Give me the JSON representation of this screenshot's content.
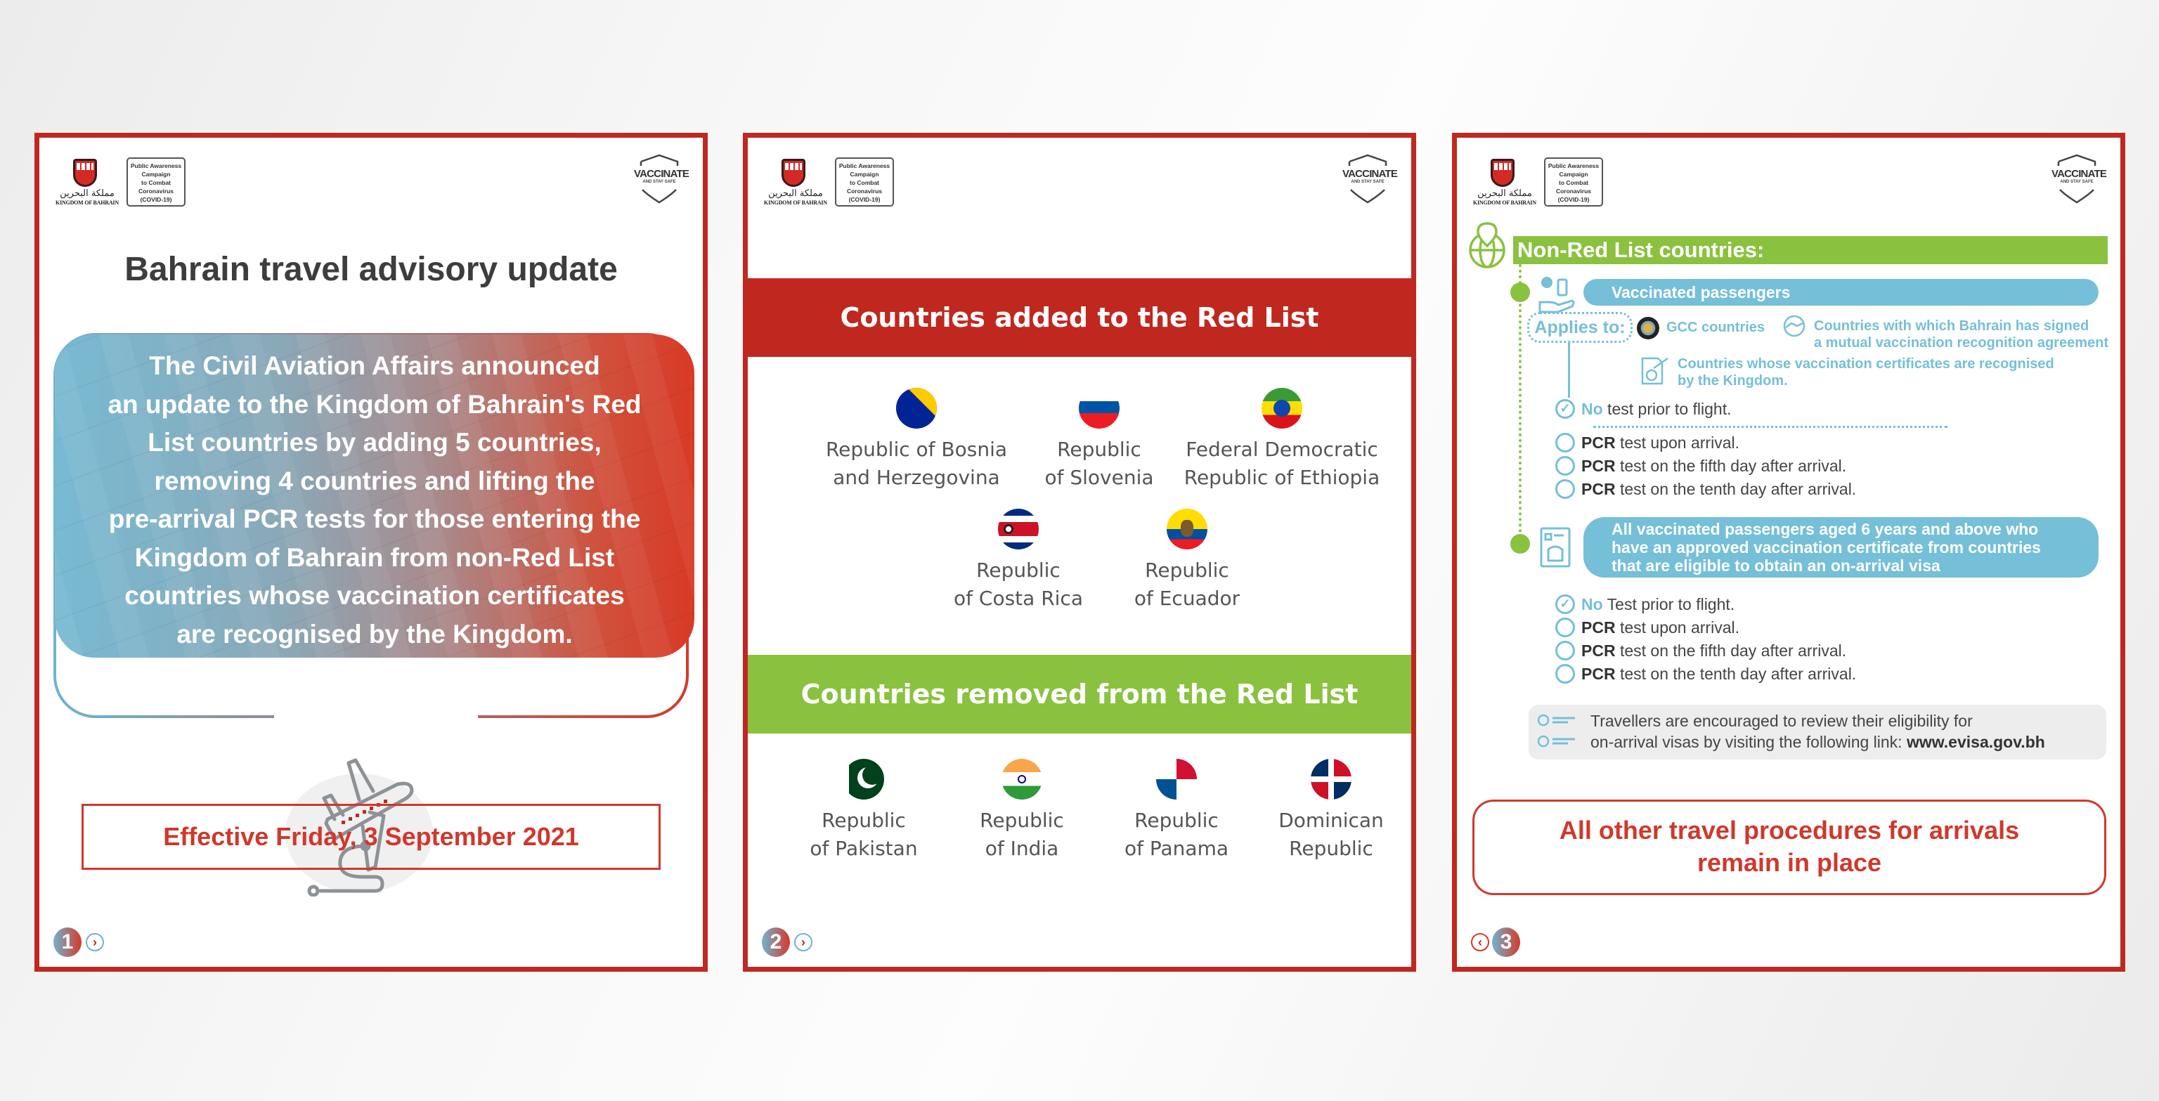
{
  "header": {
    "crest_arabic": "مملكة البحرين",
    "crest_english": "KINGDOM OF BAHRAIN",
    "campaign_lines": [
      "Public Awareness",
      "Campaign",
      "to Combat",
      "Coronavirus",
      "(COVID-19)"
    ],
    "vaccinate_title": "VACCINATE",
    "vaccinate_subtitle": "AND STAY SAFE"
  },
  "colors": {
    "border_red": "#c0281f",
    "accent_red": "#d0382c",
    "green": "#8ac13f",
    "cyan": "#75bfd8",
    "title_gray": "#3d3d3d"
  },
  "panel1": {
    "title": "Bahrain travel advisory update",
    "body_lines": [
      "The Civil Aviation Affairs announced",
      "an update to the Kingdom of Bahrain's Red",
      "List countries by adding 5 countries,",
      "removing 4 countries and lifting the",
      "pre-arrival PCR tests for those entering the",
      "Kingdom of Bahrain from non-Red List",
      "countries whose vaccination certificates",
      "are recognised by the Kingdom."
    ],
    "icon": "airplane-takeoff-icon",
    "effective": "Effective Friday, 3 September 2021",
    "page_number": "1",
    "next_arrow": "›"
  },
  "panel2": {
    "added_heading": "Countries added to the Red List",
    "added": [
      {
        "line1": "Republic of Bosnia",
        "line2": "and Herzegovina",
        "flag": "bosnia-flag-icon"
      },
      {
        "line1": "Republic",
        "line2": "of Slovenia",
        "flag": "slovenia-flag-icon"
      },
      {
        "line1": "Federal Democratic",
        "line2": "Republic of Ethiopia",
        "flag": "ethiopia-flag-icon"
      },
      {
        "line1": "Republic",
        "line2": "of Costa Rica",
        "flag": "costa-rica-flag-icon"
      },
      {
        "line1": "Republic",
        "line2": "of Ecuador",
        "flag": "ecuador-flag-icon"
      }
    ],
    "removed_heading": "Countries removed from the Red List",
    "removed": [
      {
        "line1": "Republic",
        "line2": "of Pakistan",
        "flag": "pakistan-flag-icon"
      },
      {
        "line1": "Republic",
        "line2": "of India",
        "flag": "india-flag-icon"
      },
      {
        "line1": "Republic",
        "line2": "of Panama",
        "flag": "panama-flag-icon"
      },
      {
        "line1": "Dominican",
        "line2": "Republic",
        "flag": "dominican-republic-flag-icon"
      }
    ],
    "page_number": "2",
    "next_arrow": "›"
  },
  "panel3": {
    "banner": "Non-Red List countries:",
    "vaccinated_label": "Vaccinated passengers",
    "applies_to": "Applies to:",
    "gcc": "GCC countries",
    "mutual_lines": [
      "Countries with which Bahrain has signed",
      "a mutual vaccination recognition agreement"
    ],
    "recognised_lines": [
      "Countries whose vaccination certificates are recognised",
      "by the Kingdom."
    ],
    "group1": [
      {
        "prefix": "No",
        "text": " test prior to flight.",
        "checked": true
      },
      {
        "prefix": "PCR",
        "text": " test upon arrival.",
        "checked": false
      },
      {
        "prefix": "PCR",
        "text": " test on the fifth day after arrival.",
        "checked": false
      },
      {
        "prefix": "PCR",
        "text": " test on the tenth day after arrival.",
        "checked": false
      }
    ],
    "visa_lines": [
      "All vaccinated passengers aged 6 years and above who",
      "have an approved vaccination certificate from countries",
      "that are eligible to obtain an on-arrival visa"
    ],
    "group2": [
      {
        "prefix": "No",
        "text": " Test prior to flight.",
        "checked": true
      },
      {
        "prefix": "PCR",
        "text": " test upon arrival.",
        "checked": false
      },
      {
        "prefix": "PCR",
        "text": " test on the fifth day after arrival.",
        "checked": false
      },
      {
        "prefix": "PCR",
        "text": " test on the tenth day after arrival.",
        "checked": false
      }
    ],
    "note_line1": "Travellers are encouraged to review their eligibility for",
    "note_line2": "on-arrival visas by visiting the following link: ",
    "note_link": "www.evisa.gov.bh",
    "other_lines": [
      "All other travel procedures for arrivals",
      "remain in place"
    ],
    "page_number": "3",
    "prev_arrow": "‹",
    "check_glyph": "✓"
  }
}
